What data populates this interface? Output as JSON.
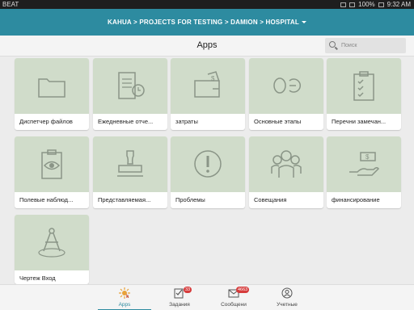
{
  "statusbar": {
    "left_text": "ВЕАТ",
    "battery": "100%",
    "time": "9:32 AM"
  },
  "header": {
    "breadcrumb": "KAHUA > PROJECTS FOR TESTING > DAMION > HOSPITAL"
  },
  "titlebar": {
    "title": "Apps",
    "search_placeholder": "Поиск"
  },
  "apps": [
    {
      "label": "Диспетчер файлов",
      "icon": "folder-icon"
    },
    {
      "label": "Ежедневные отче...",
      "icon": "daily-report-icon"
    },
    {
      "label": "затраты",
      "icon": "wallet-icon"
    },
    {
      "label": "Основные этапы",
      "icon": "milestone-icon"
    },
    {
      "label": "Перечни замечан...",
      "icon": "checklist-icon"
    },
    {
      "label": "Полевые наблюд...",
      "icon": "observation-icon"
    },
    {
      "label": "Представляемая...",
      "icon": "stamp-icon"
    },
    {
      "label": "Проблемы",
      "icon": "issue-icon"
    },
    {
      "label": "Совещания",
      "icon": "meeting-icon"
    },
    {
      "label": "финансирование",
      "icon": "funding-icon"
    },
    {
      "label": "Чертеж Вход",
      "icon": "drawing-icon"
    }
  ],
  "tabs": [
    {
      "label": "Apps",
      "badge": ""
    },
    {
      "label": "Задания",
      "badge": "33"
    },
    {
      "label": "Сообщени",
      "badge": "4663"
    },
    {
      "label": "Учетные",
      "badge": ""
    }
  ],
  "colors": {
    "accent": "#2d8ba0",
    "tile_art": "#d0dcca",
    "icon_stroke": "#8a9587",
    "badge": "#d63b3b"
  }
}
